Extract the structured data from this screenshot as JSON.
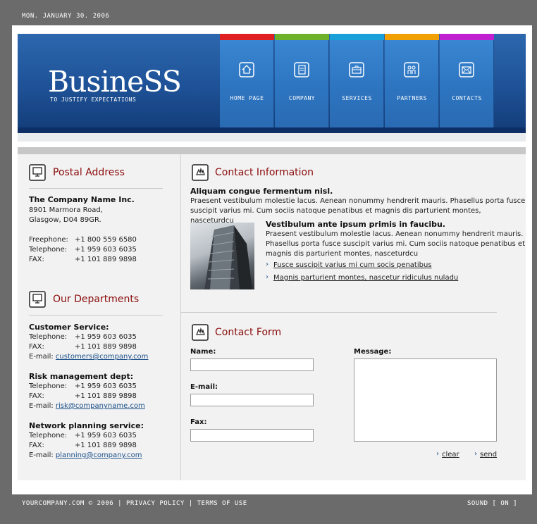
{
  "top": {
    "date": "MON. JANUARY 30. 2006"
  },
  "header": {
    "logo": "BusineSS",
    "tagline": "TO JUSTIFY EXPECTATIONS",
    "nav": [
      {
        "label": "HOME PAGE",
        "color": "#e02020",
        "icon": "home-icon"
      },
      {
        "label": "COMPANY",
        "color": "#6db22a",
        "icon": "document-icon"
      },
      {
        "label": "SERVICES",
        "color": "#1aa0d8",
        "icon": "briefcase-icon"
      },
      {
        "label": "PARTNERS",
        "color": "#f0a000",
        "icon": "people-icon"
      },
      {
        "label": "CONTACTS",
        "color": "#c020d0",
        "icon": "envelope-icon"
      }
    ]
  },
  "postal": {
    "title": "Postal Address",
    "company": "The Company Name Inc.",
    "street": "8901 Marmora Road,",
    "city": "Glasgow, D04 89GR.",
    "freephone_label": "Freephone:",
    "freephone": "+1 800 559 6580",
    "telephone_label": "Telephone:",
    "telephone": "+1 959 603 6035",
    "fax_label": "FAX:",
    "fax": "+1 101 889 9898"
  },
  "departments": {
    "title": "Our Departments",
    "items": [
      {
        "name": "Customer Service:",
        "telephone": "+1 959 603 6035",
        "fax": "+1 101 889 9898",
        "email": "customers@company.com"
      },
      {
        "name": "Risk management dept:",
        "telephone": "+1 959 603 6035",
        "fax": "+1 101 889 9898",
        "email": "risk@companyname.com"
      },
      {
        "name": "Network planning service:",
        "telephone": "+1 959 603 6035",
        "fax": "+1 101 889 9898",
        "email": "planning@company.com"
      }
    ],
    "telephone_label": "Telephone:",
    "fax_label": "FAX:",
    "email_label": "E-mail:"
  },
  "contact_info": {
    "title": "Contact Information",
    "heading1": "Aliquam congue fermentum nisl.",
    "para1_line1": "Praesent vestibulum molestie lacus. Aenean nonummy hendrerit mauris. Phasellus porta fusce",
    "para1_line2": "suscipit varius mi. Cum sociis natoque penatibus et magnis dis parturient montes, nasceturdcu",
    "heading2": "Vestibulum ante ipsum primis in faucibu.",
    "para2_line1": "Praesent vestibulum molestie lacus. Aenean nonummy hendrerit mauris.",
    "para2_line2": "Phasellus porta fusce suscipit varius mi. Cum sociis natoque penatibus et",
    "para2_line3": "magnis dis parturient montes, nasceturdcu",
    "link1": "Fusce suscipit varius mi cum socis penatibus",
    "link2": "Magnis parturient montes, nascetur ridiculus nuladu"
  },
  "form": {
    "title": "Contact Form",
    "name_label": "Name:",
    "email_label": "E-mail:",
    "fax_label": "Fax:",
    "message_label": "Message:",
    "name_value": "",
    "email_value": "",
    "fax_value": "",
    "message_value": "",
    "clear": "clear",
    "send": "send"
  },
  "footer": {
    "copyright": "YOURCOMPANY.COM © 2006",
    "privacy": "PRIVACY POLICY",
    "terms": "TERMS OF USE",
    "separator": "|",
    "sound": "SOUND [ ON ]"
  }
}
